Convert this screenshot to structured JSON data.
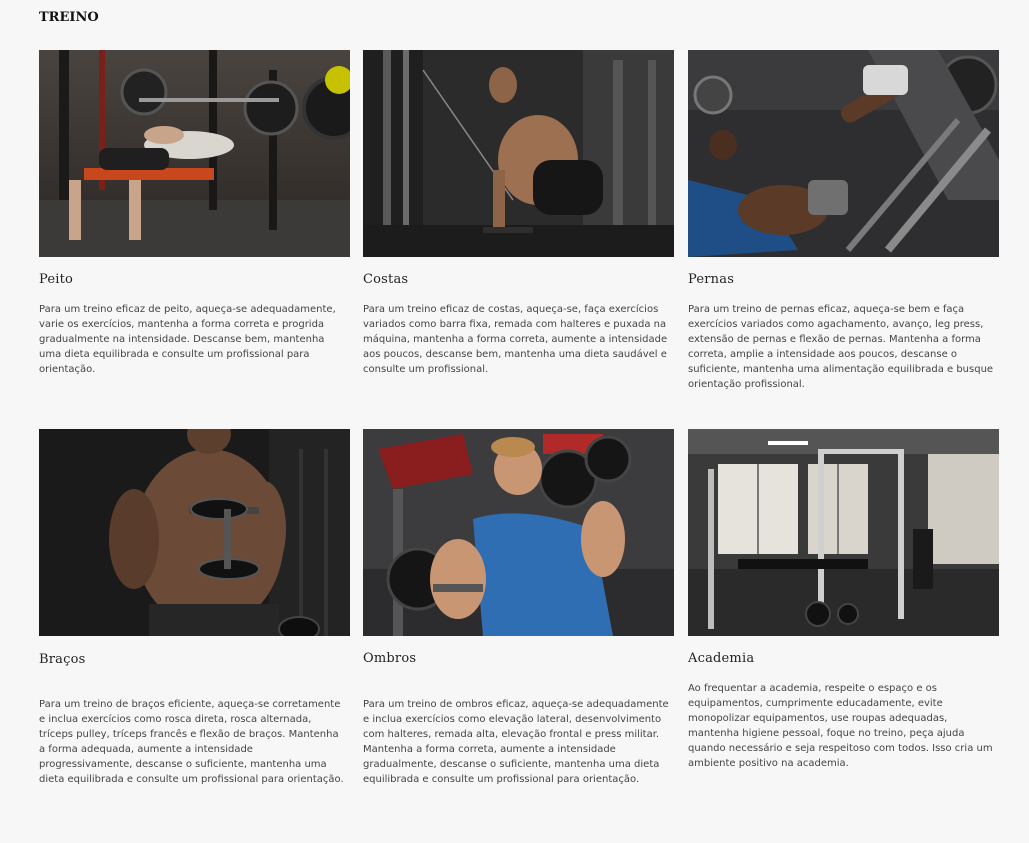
{
  "page": {
    "title": "TREINO"
  },
  "cards": [
    {
      "title": "Peito",
      "text": "Para um treino eficaz de peito, aqueça-se adequadamente, varie os exercícios, mantenha a forma correta e progrida gradualmente na intensidade. Descanse bem, mantenha uma dieta equilibrada e consulte um profissional para orientação."
    },
    {
      "title": "Costas",
      "text": "Para um treino eficaz de costas, aqueça-se, faça exercícios variados como barra fixa, remada com halteres e puxada na máquina, mantenha a forma correta, aumente a intensidade aos poucos, descanse bem, mantenha uma dieta saudável e consulte um profissional."
    },
    {
      "title": "Pernas",
      "text": "Para um treino de pernas eficaz, aqueça-se bem e faça exercícios variados como agachamento, avanço, leg press, extensão de pernas e flexão de pernas. Mantenha a forma correta, amplie a intensidade aos poucos, descanse o suficiente, mantenha uma alimentação equilibrada e busque orientação profissional."
    },
    {
      "title": "Braços",
      "text": "Para um treino de braços eficiente, aqueça-se corretamente e inclua exercícios como rosca direta, rosca alternada, tríceps pulley, tríceps francês e flexão de braços. Mantenha a forma adequada, aumente a intensidade progressivamente, descanse o suficiente, mantenha uma dieta equilibrada e consulte um profissional para orientação."
    },
    {
      "title": "Ombros",
      "text": "Para um treino de ombros eficaz, aqueça-se adequadamente e inclua exercícios como elevação lateral, desenvolvimento com halteres, remada alta, elevação frontal e press militar. Mantenha a forma correta, aumente a intensidade gradualmente, descanse o suficiente, mantenha uma dieta equilibrada e consulte um profissional para orientação."
    },
    {
      "title": "Academia",
      "text": "Ao frequentar a academia, respeite o espaço e os equipamentos, cumprimente educadamente, evite monopolizar equipamentos, use roupas adequadas, mantenha higiene pessoal, foque no treino, peça ajuda quando necessário e seja respeitoso com todos. Isso cria um ambiente positivo na academia."
    }
  ]
}
